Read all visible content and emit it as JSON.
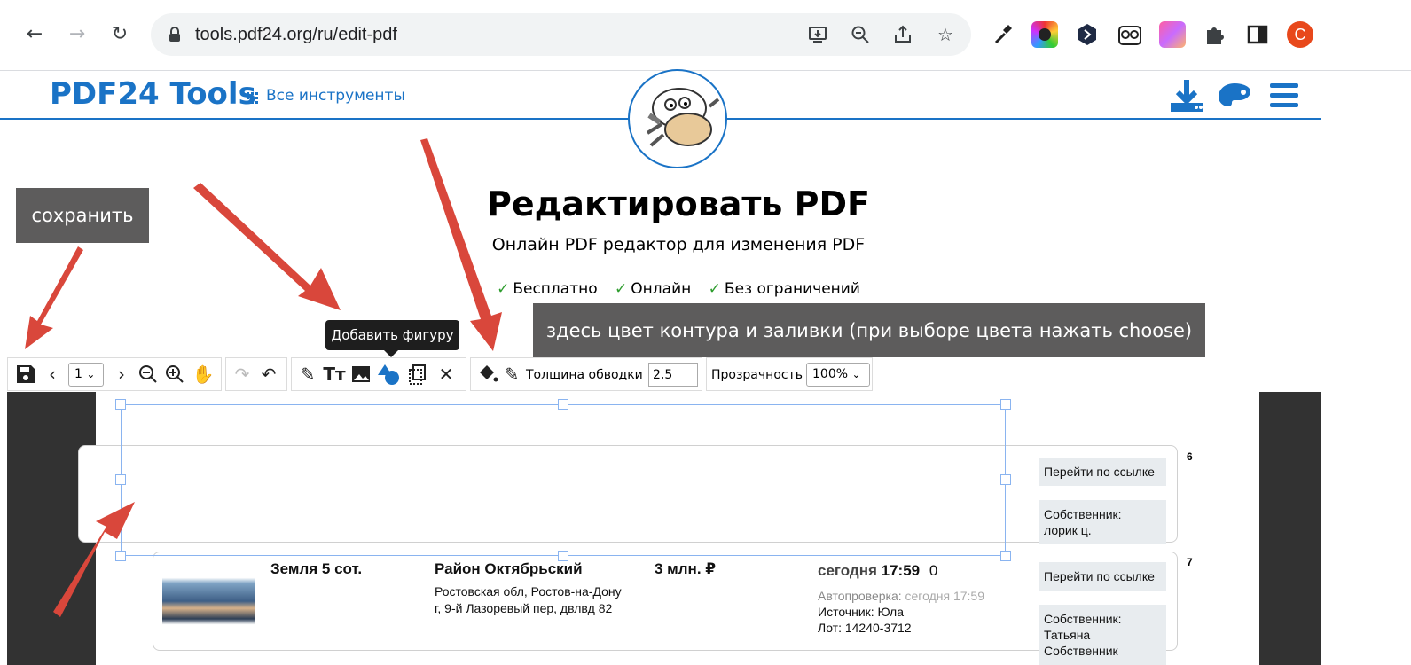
{
  "browser": {
    "url": "tools.pdf24.org/ru/edit-pdf",
    "avatar_letter": "C",
    "colors": {
      "avatar": "#e8481b",
      "omnibox": "#f1f3f4"
    }
  },
  "site": {
    "logo": "PDF24 Tools",
    "all_tools": "Все инструменты",
    "brand_color": "#1a73c6"
  },
  "hero": {
    "title": "Редактировать PDF",
    "subtitle": "Онлайн PDF редактор для изменения PDF",
    "features": [
      "Бесплатно",
      "Онлайн",
      "Без ограничений"
    ]
  },
  "annotations": {
    "save_callout": "сохранить",
    "color_callout": "здесь цвет контура и заливки (при выборе цвета нажать choose)",
    "tooltip": "Добавить фигуру",
    "arrow_color": "#d9473b"
  },
  "toolbar": {
    "page_select": "1",
    "stroke_label": "Толщина обводки",
    "stroke_value": "2,5",
    "opacity_label": "Прозрачность",
    "opacity_value": "100%"
  },
  "pdf": {
    "items": [
      {
        "index": "6",
        "button": "Перейти по ссылке",
        "owner": [
          "Собственник:",
          "лорик ц."
        ]
      },
      {
        "index": "7",
        "title": "Земля 5 сот.",
        "district": "Район Октябрьский",
        "address": [
          "Ростовская обл, Ростов-на-Дону",
          "г, 9-й Лазоревый пер, двлвд 82"
        ],
        "price": "3 млн. ₽",
        "date_prefix": "сегодня",
        "time": "17:59",
        "count": "0",
        "autocheck_label": "Автопроверка:",
        "autocheck_value": "сегодня 17:59",
        "source": "Источник: Юла",
        "lot": "Лот: 14240-3712",
        "button": "Перейти по ссылке",
        "owner": [
          "Собственник:",
          "Татьяна",
          "Собственник"
        ]
      }
    ]
  }
}
